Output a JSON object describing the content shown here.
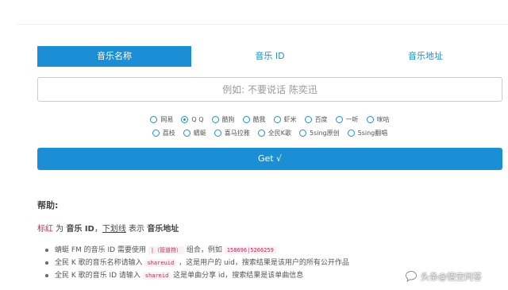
{
  "tabs": [
    {
      "label": "音乐名称",
      "active": true
    },
    {
      "label": "音乐 ID",
      "active": false
    },
    {
      "label": "音乐地址",
      "active": false
    }
  ],
  "search": {
    "placeholder": "例如: 不要说话 陈奕迅",
    "value": ""
  },
  "sources": {
    "row1": [
      {
        "label": "网易",
        "checked": false
      },
      {
        "label": "Q Q",
        "checked": true
      },
      {
        "label": "酷狗",
        "checked": false
      },
      {
        "label": "酷我",
        "checked": false
      },
      {
        "label": "虾米",
        "checked": false
      },
      {
        "label": "百度",
        "checked": false
      },
      {
        "label": "一听",
        "checked": false
      },
      {
        "label": "咪咕",
        "checked": false
      }
    ],
    "row2": [
      {
        "label": "荔枝",
        "checked": false
      },
      {
        "label": "蜻蜓",
        "checked": false
      },
      {
        "label": "喜马拉雅",
        "checked": false
      },
      {
        "label": "全民K歌",
        "checked": false
      },
      {
        "label": "5sing原创",
        "checked": false
      },
      {
        "label": "5sing翻唱",
        "checked": false
      }
    ]
  },
  "get_button": {
    "label": "Get √"
  },
  "help": {
    "title": "帮助:",
    "legend": {
      "red_word": "标红",
      "t1": " 为 ",
      "music_id": "音乐 ID",
      "t2": "，",
      "underline_word": "下划线",
      "t3": " 表示 ",
      "music_url": "音乐地址"
    },
    "items": [
      {
        "text": "蜻蜓 FM 的音乐 ID 需要使用 ",
        "code": "|（管道符）",
        "text2": " 组合，例如 ",
        "code2": "158696|5266259"
      },
      {
        "text": "全民 K 歌的音乐名称请输入 ",
        "code": "shareuid",
        "text2": " ，这是用户的 uid，搜索结果是该用户的所有公开作品",
        "code2": ""
      },
      {
        "text": "全民 K 歌的音乐 ID 请输入 ",
        "code": "shareid",
        "text2": " 这是单曲分享 id，搜索结果是该单曲信息",
        "code2": ""
      }
    ]
  },
  "watermark": {
    "text": "头条@悟空问答",
    "icon": "chat-bubble-icon"
  },
  "colors": {
    "accent": "#1a8fd6",
    "code_red": "#c7254e"
  }
}
